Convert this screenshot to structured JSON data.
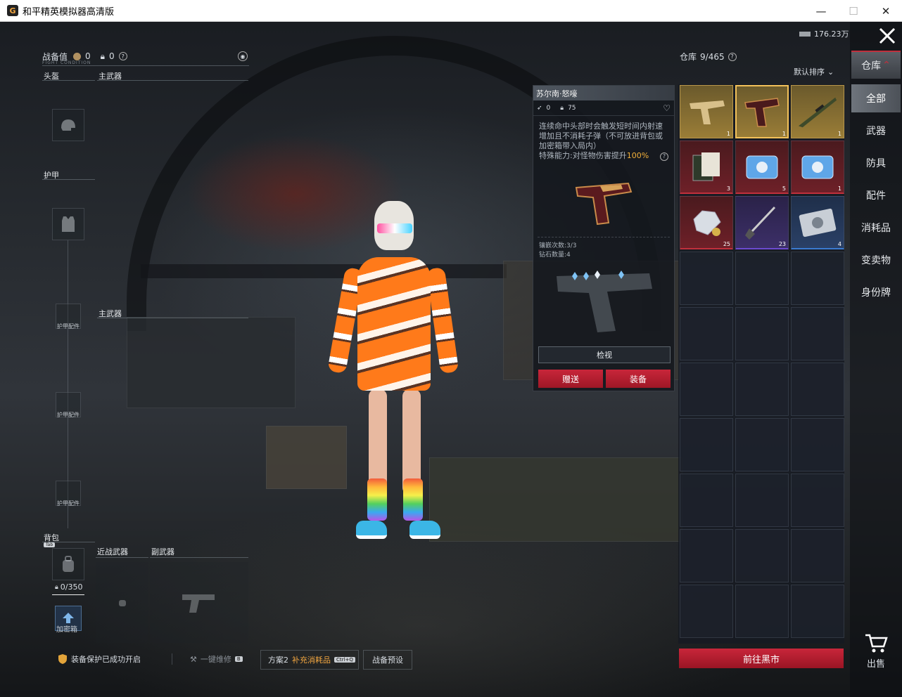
{
  "window": {
    "title": "和平精英模拟器高清版",
    "minimize": "—",
    "maximize": "☐",
    "close": "✕"
  },
  "equipment": {
    "label": "战备值",
    "value_a": "0",
    "value_b": "0",
    "subtitle": "FIGHT CONDITION",
    "helmet": "头盔",
    "primary_weapon_top": "主武器",
    "armor": "护甲",
    "primary_weapon_mid": "主武器",
    "armor_attachment": "护甲配件",
    "backpack": "背包",
    "tab_tag": "Tab",
    "capacity": "0/350",
    "melee": "近战武器",
    "secondary": "副武器",
    "safebox": "加密箱"
  },
  "bottom_bar": {
    "protection": "装备保护已成功开启",
    "repair": "一键维修",
    "repair_tag": "B",
    "plan": "方案2",
    "supply": "补充消耗品",
    "supply_tag": "Ctrl+Q",
    "preset": "战备预设"
  },
  "detail": {
    "name": "苏尔南·怒嚎",
    "stat_a": "0",
    "stat_b": "75",
    "description": "连续命中头部时会触发短时间内射速增加且不消耗子弹（不可放进背包或加密箱带入局内）",
    "ability_prefix": "特殊能力:对怪物伤害提升",
    "ability_value": "100%",
    "inlay_count": "镶嵌次数:3/3",
    "diamond_count": "钻石数量:4",
    "inspect": "检视",
    "gift": "赠送",
    "equip": "装备"
  },
  "warehouse": {
    "currency": "176.23万",
    "title": "仓库",
    "capacity": "9/465",
    "sort": "默认排序",
    "items": [
      {
        "qty": "1",
        "color": "gold",
        "icon": "golden-pistol-icon"
      },
      {
        "qty": "1",
        "color": "gold",
        "icon": "pistol-icon"
      },
      {
        "qty": "1",
        "color": "gold",
        "icon": "sniper-rifle-icon"
      },
      {
        "qty": "3",
        "color": "red",
        "icon": "document-icon"
      },
      {
        "qty": "5",
        "color": "red",
        "icon": "card-icon"
      },
      {
        "qty": "1",
        "color": "red",
        "icon": "card-icon"
      },
      {
        "qty": "25",
        "color": "red",
        "icon": "diamond-icon"
      },
      {
        "qty": "23",
        "color": "purple",
        "icon": "shovel-icon"
      },
      {
        "qty": "4",
        "color": "blue",
        "icon": "gear-card-icon"
      }
    ],
    "market_button": "前往黑市"
  },
  "sidenav": {
    "warehouse": "仓库",
    "all": "全部",
    "weapons": "武器",
    "armor": "防具",
    "attachments": "配件",
    "consumables": "消耗品",
    "sellables": "变卖物",
    "id_card": "身份牌",
    "sell": "出售"
  }
}
